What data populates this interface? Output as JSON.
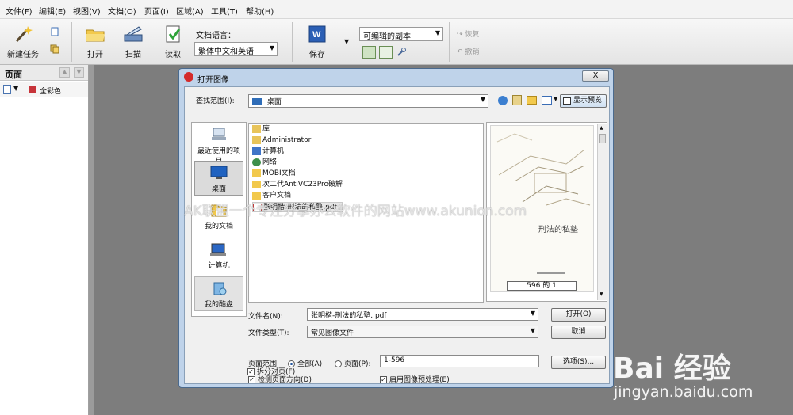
{
  "menu": [
    "文件(F)",
    "编辑(E)",
    "视图(V)",
    "文档(O)",
    "页面(I)",
    "区域(A)",
    "工具(T)",
    "帮助(H)"
  ],
  "toolbar": {
    "new_task": "新建任务",
    "open": "打开",
    "scan": "扫描",
    "read": "读取",
    "doc_lang_label": "文档语言：",
    "doc_lang_value": "繁体中文和英语",
    "save": "保存",
    "save_format": "可编辑的副本",
    "restore": "恢复",
    "undo": "撤销"
  },
  "left_panel": {
    "title": "页面",
    "color_mode": "全彩色"
  },
  "dialog": {
    "title": "打开图像",
    "close": "X",
    "look_in_label": "查找范围(I):",
    "look_in_value": "桌面",
    "preview_button": "显示预览",
    "places": [
      "最近使用的项目",
      "桌面",
      "我的文档",
      "计算机",
      "我的酷盘"
    ],
    "files": [
      "库",
      "Administrator",
      "计算机",
      "网络",
      "MOBI文档",
      "次二代AntiVC23Pro破解",
      "客户文档",
      "张明楷-刑法的私塾.pdf"
    ],
    "preview_title": "刑法的私塾",
    "preview_page": "596 的 1",
    "filename_label": "文件名(N):",
    "filename_value": "张明楷-刑法的私塾. pdf",
    "filetype_label": "文件类型(T):",
    "filetype_value": "常见图像文件",
    "open_button": "打开(O)",
    "cancel_button": "取消",
    "page_range_label": "页面范围:",
    "all_option": "全部(A)",
    "pages_option": "页面(P):",
    "pages_value": "1-596",
    "options_button": "选项(S)...",
    "detect_orientation": "检测页面方向(D)",
    "split_pages": "拆分对页(F)",
    "enable_preprocess": "启用图像预处理(E)"
  },
  "watermarks": {
    "ak": "AK联盟一个专注分享办公软件的网站www.akunion.com",
    "baidu": "Bai 经验",
    "url": "jingyan.baidu.com"
  }
}
